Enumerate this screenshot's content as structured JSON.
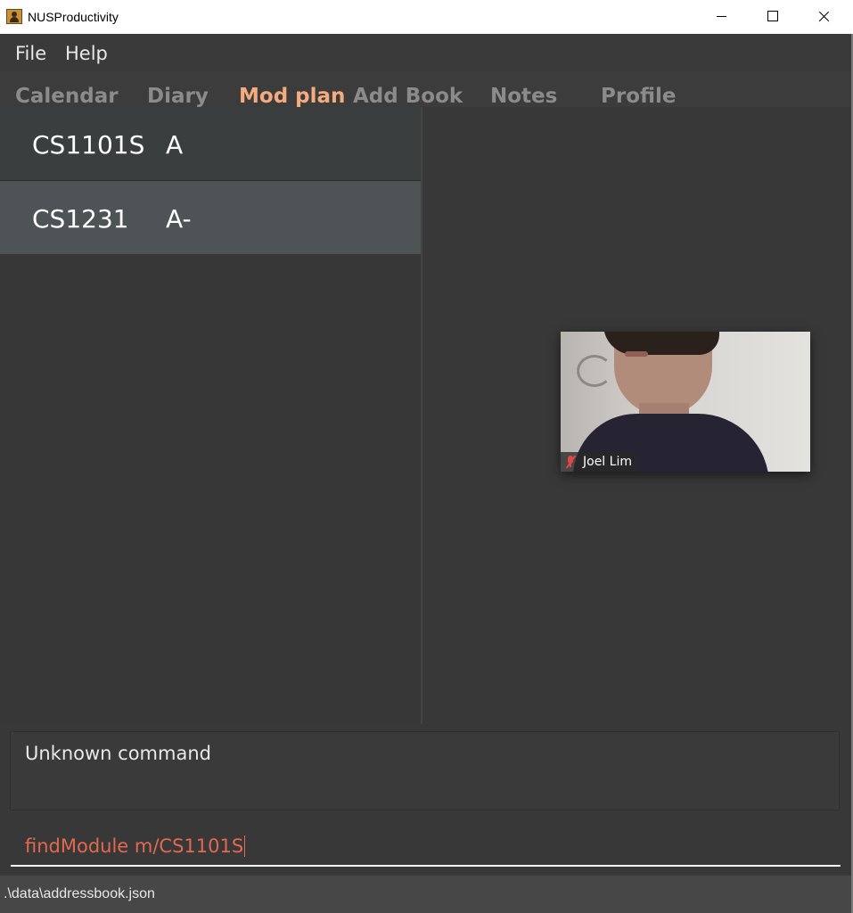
{
  "window": {
    "title": "NUSProductivity"
  },
  "menu": {
    "file": "File",
    "help": "Help"
  },
  "tabs": [
    {
      "label": "Calendar",
      "active": false
    },
    {
      "label": "Diary",
      "active": false
    },
    {
      "label": "Mod plan",
      "active": true
    },
    {
      "label": "Add Book",
      "active": false
    },
    {
      "label": "Notes",
      "active": false
    },
    {
      "label": "Profile",
      "active": false
    }
  ],
  "modules": [
    {
      "code": "CS1101S",
      "grade": "A"
    },
    {
      "code": "CS1231",
      "grade": "A-"
    }
  ],
  "video_overlay": {
    "participant_name": "Joel Lim",
    "mic_state": "muted"
  },
  "result": {
    "text": "Unknown command"
  },
  "command": {
    "value": "findModule m/CS1101S"
  },
  "status": {
    "path": ".\\data\\addressbook.json"
  },
  "colors": {
    "accent_tab": "#f6ab7f",
    "command_text": "#e2694f",
    "selected_row": "#4e5456"
  }
}
